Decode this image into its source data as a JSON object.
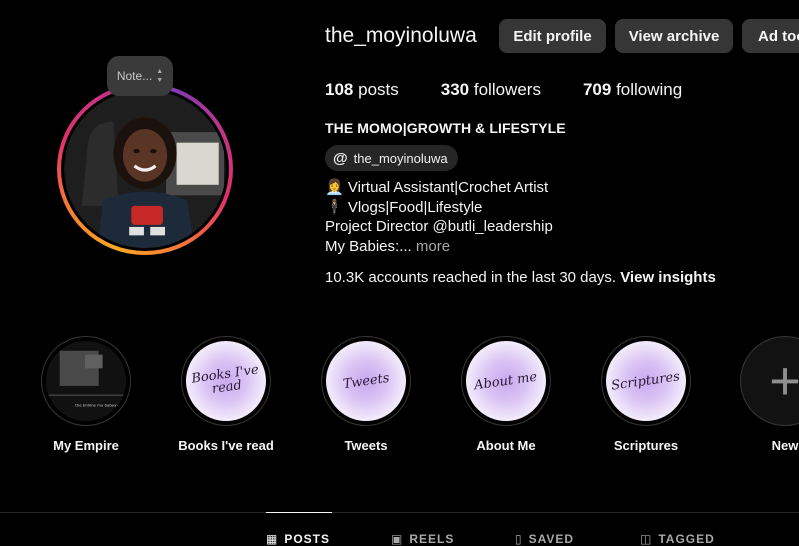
{
  "profile": {
    "username": "the_moyinoluwa",
    "note_placeholder": "Note...",
    "buttons": {
      "edit": "Edit profile",
      "archive": "View archive",
      "ad": "Ad tools"
    },
    "stats": {
      "posts_count": "108",
      "posts_label": "posts",
      "followers_count": "330",
      "followers_label": "followers",
      "following_count": "709",
      "following_label": "following"
    },
    "full_name": "THE MOMO|GROWTH & LIFESTYLE",
    "threads_handle": "the_moyinoluwa",
    "bio": {
      "line1": "👩‍💼 Virtual Assistant|Crochet Artist",
      "line2": "🕴 Vlogs|Food|Lifestyle",
      "line3": "Project Director @butli_leadership",
      "line4": "My Babies:...",
      "more": "more"
    },
    "reach": {
      "text": "10.3K accounts reached in the last 30 days.",
      "link": "View insights"
    }
  },
  "highlights": [
    {
      "label": "My Empire",
      "cover_text": "the bnlline my babyyyy"
    },
    {
      "label": "Books I've read",
      "cover_text": "Books I've read"
    },
    {
      "label": "Tweets",
      "cover_text": "Tweets"
    },
    {
      "label": "About Me",
      "cover_text": "About me"
    },
    {
      "label": "Scriptures",
      "cover_text": "Scriptures"
    },
    {
      "label": "New"
    }
  ],
  "tabs": [
    {
      "label": "POSTS",
      "icon": "grid-icon",
      "active": true
    },
    {
      "label": "REELS",
      "icon": "reels-icon"
    },
    {
      "label": "SAVED",
      "icon": "bookmark-icon"
    },
    {
      "label": "TAGGED",
      "icon": "tag-icon"
    }
  ],
  "colors": {
    "background": "#000000",
    "button_bg": "#363636",
    "muted_text": "#a8a8a8",
    "highlight_purple": "#c9a9ef"
  }
}
